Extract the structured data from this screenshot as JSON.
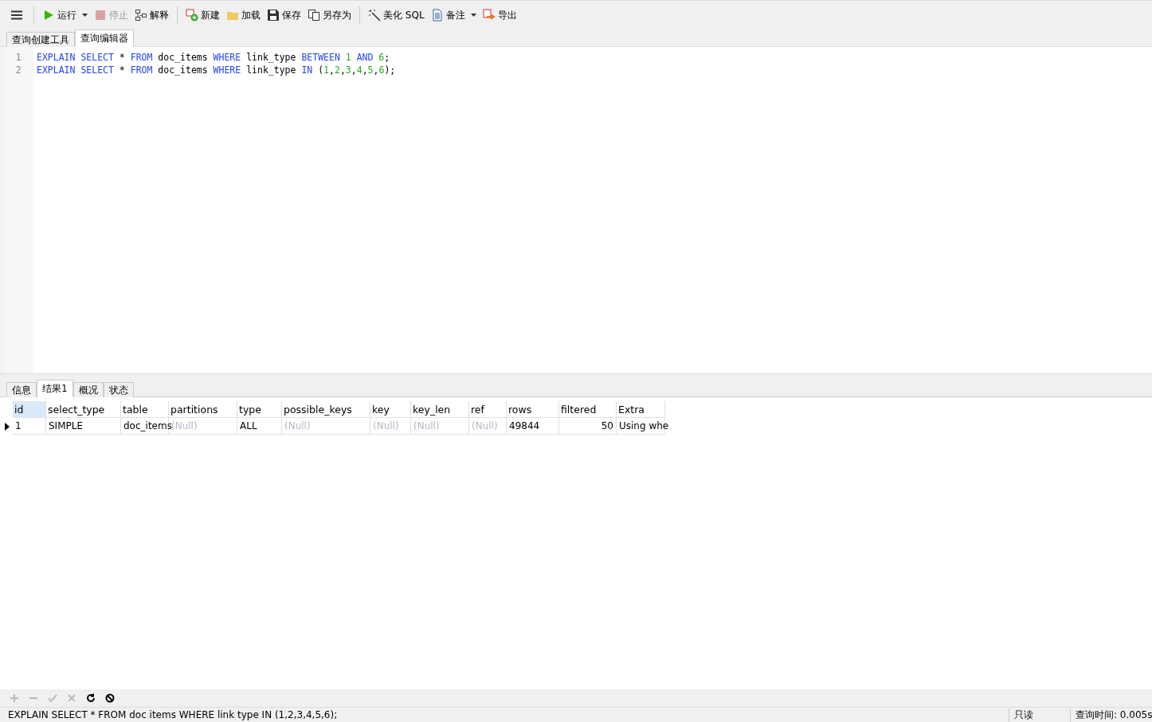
{
  "toolbar": [
    {
      "label": "运行",
      "disabled": false,
      "dropdown": true
    },
    {
      "label": "停止",
      "disabled": true,
      "dropdown": false
    },
    {
      "label": "解释",
      "disabled": false,
      "dropdown": false
    },
    {
      "label": "新建",
      "disabled": false,
      "dropdown": false
    },
    {
      "label": "加载",
      "disabled": false,
      "dropdown": false
    },
    {
      "label": "保存",
      "disabled": false,
      "dropdown": false
    },
    {
      "label": "另存为",
      "disabled": false,
      "dropdown": false
    },
    {
      "label": "美化 SQL",
      "disabled": false,
      "dropdown": false
    },
    {
      "label": "备注",
      "disabled": false,
      "dropdown": true
    },
    {
      "label": "导出",
      "disabled": false,
      "dropdown": false
    }
  ],
  "editor_tabs": [
    {
      "label": "查询创建工具",
      "selected": false
    },
    {
      "label": "查询编辑器",
      "selected": true
    }
  ],
  "editor_lines": [
    {
      "number": "1",
      "tokens": [
        {
          "kind": "keyword",
          "text": "EXPLAIN SELECT"
        },
        {
          "kind": "plain",
          "text": " * "
        },
        {
          "kind": "keyword",
          "text": "FROM"
        },
        {
          "kind": "plain",
          "text": " doc_items "
        },
        {
          "kind": "keyword",
          "text": "WHERE"
        },
        {
          "kind": "plain",
          "text": " link_type "
        },
        {
          "kind": "keyword",
          "text": "BETWEEN "
        },
        {
          "kind": "number",
          "text": "1"
        },
        {
          "kind": "keyword",
          "text": " AND "
        },
        {
          "kind": "number",
          "text": "6"
        },
        {
          "kind": "plain",
          "text": ";"
        }
      ]
    },
    {
      "number": "2",
      "tokens": [
        {
          "kind": "keyword",
          "text": "EXPLAIN SELECT"
        },
        {
          "kind": "plain",
          "text": " * "
        },
        {
          "kind": "keyword",
          "text": "FROM"
        },
        {
          "kind": "plain",
          "text": " doc_items "
        },
        {
          "kind": "keyword",
          "text": "WHERE"
        },
        {
          "kind": "plain",
          "text": " link_type "
        },
        {
          "kind": "keyword",
          "text": "IN"
        },
        {
          "kind": "plain",
          "text": " ("
        },
        {
          "kind": "number",
          "text": "1"
        },
        {
          "kind": "plain",
          "text": ","
        },
        {
          "kind": "number",
          "text": "2"
        },
        {
          "kind": "plain",
          "text": ","
        },
        {
          "kind": "number",
          "text": "3"
        },
        {
          "kind": "plain",
          "text": ","
        },
        {
          "kind": "number",
          "text": "4"
        },
        {
          "kind": "plain",
          "text": ","
        },
        {
          "kind": "number",
          "text": "5"
        },
        {
          "kind": "plain",
          "text": ","
        },
        {
          "kind": "number",
          "text": "6"
        },
        {
          "kind": "plain",
          "text": ");"
        }
      ]
    }
  ],
  "result_tabs": [
    {
      "label": "信息",
      "selected": false
    },
    {
      "label": "结果1",
      "selected": true
    },
    {
      "label": "概况",
      "selected": false
    },
    {
      "label": "状态",
      "selected": false
    }
  ],
  "table": {
    "columns": [
      {
        "label": "id",
        "selected": true
      },
      {
        "label": "select_type",
        "selected": false
      },
      {
        "label": "table",
        "selected": false
      },
      {
        "label": "partitions",
        "selected": false
      },
      {
        "label": "type",
        "selected": false
      },
      {
        "label": "possible_keys",
        "selected": false
      },
      {
        "label": "key",
        "selected": false
      },
      {
        "label": "key_len",
        "selected": false
      },
      {
        "label": "ref",
        "selected": false
      },
      {
        "label": "rows",
        "selected": false
      },
      {
        "label": "filtered",
        "selected": false
      },
      {
        "label": "Extra",
        "selected": false
      }
    ],
    "rows": [
      {
        "selected": true,
        "cells": [
          {
            "text": "1",
            "null": false
          },
          {
            "text": "SIMPLE",
            "null": false
          },
          {
            "text": "doc_items",
            "null": false
          },
          {
            "text": "(Null)",
            "null": true
          },
          {
            "text": "ALL",
            "null": false
          },
          {
            "text": "(Null)",
            "null": true
          },
          {
            "text": "(Null)",
            "null": true
          },
          {
            "text": "(Null)",
            "null": true
          },
          {
            "text": "(Null)",
            "null": true
          },
          {
            "text": "49844",
            "null": false
          },
          {
            "text": "50",
            "null": false
          },
          {
            "text": "Using whe",
            "null": false
          }
        ]
      }
    ]
  },
  "grid_buttons": [
    {
      "disabled": true
    },
    {
      "disabled": true
    },
    {
      "disabled": true
    },
    {
      "disabled": true
    },
    {
      "disabled": false
    },
    {
      "disabled": false
    }
  ],
  "status_bar": {
    "query": "EXPLAIN SELECT * FROM doc items WHERE link type IN (1,2,3,4,5,6);",
    "mode": "只读",
    "time": "查询时间: 0.005s"
  }
}
